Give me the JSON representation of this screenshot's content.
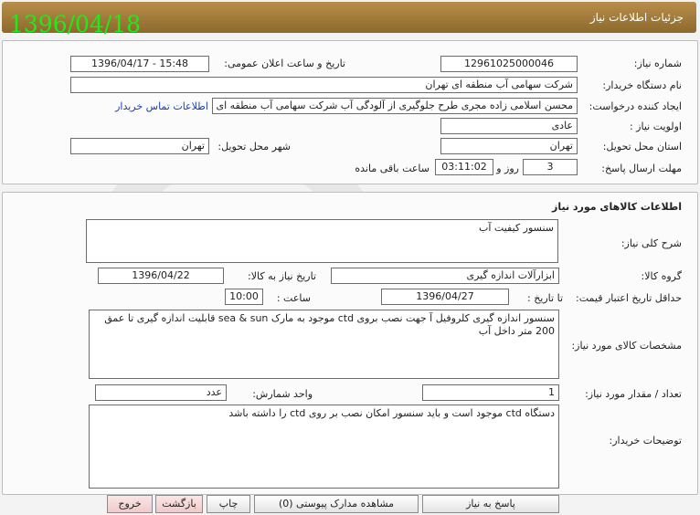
{
  "header": {
    "title": "جزئیات اطلاعات نیاز",
    "date_stamp": "1396/04/18"
  },
  "info": {
    "need_number_label": "شماره نیاز:",
    "need_number": "12961025000046",
    "announce_label": "تاریخ و ساعت اعلان عمومی:",
    "announce_value": "1396/04/17 - 15:48",
    "buyer_org_label": "نام دستگاه خریدار:",
    "buyer_org": "شرکت سهامی آب منطقه ای تهران",
    "requester_label": "ایجاد کننده درخواست:",
    "requester": "محسن اسلامی زاده مجری طرح جلوگیری از آلودگی آب شرکت سهامی آب منطقه ای تهران",
    "contact_link": "اطلاعات تماس خریدار",
    "priority_label": "اولویت نیاز :",
    "priority": "عادی",
    "province_label": "استان محل تحویل:",
    "province": "تهران",
    "city_label": "شهر محل تحویل:",
    "city": "تهران",
    "deadline_label": "مهلت ارسال پاسخ:",
    "days": "3",
    "days_label": "روز و",
    "time_left": "03:11:02",
    "time_left_label": "ساعت باقی مانده"
  },
  "goods": {
    "section_title": "اطلاعات کالاهای مورد نیاز",
    "summary_label": "شرح کلی نیاز:",
    "summary": "سنسور کیفیت آب",
    "group_label": "گروه کالا:",
    "group": "ابزارآلات اندازه گیری",
    "need_date_label": "تاریخ نیاز به کالا:",
    "need_date": "1396/04/22",
    "min_price_label": "حداقل تاریخ اعتبار قیمت:",
    "until_date_label": "تا تاریخ :",
    "until_date": "1396/04/27",
    "hour_label": "ساعت :",
    "hour": "10:00",
    "spec_label": "مشخصات کالای مورد نیاز:",
    "spec": "سنسور اندازه گیری کلروفیل آ جهت نصب بروی ctd موجود به مارک sea & sun قابلیت اندازه گیری تا عمق 200 متر داخل آب",
    "qty_label": "تعداد / مقدار مورد نیاز:",
    "qty": "1",
    "unit_label": "واحد شمارش:",
    "unit": "عدد",
    "buyer_notes_label": "توضیحات خریدار:",
    "buyer_notes": "دستگاه ctd موجود است و باید سنسور امکان نصب بر روی ctd را داشته باشد"
  },
  "buttons": {
    "reply": "پاسخ به نیاز",
    "attachments": "مشاهده مدارک پیوستی (0)",
    "print": "چاپ",
    "back": "بازگشت",
    "exit": "خروج"
  }
}
